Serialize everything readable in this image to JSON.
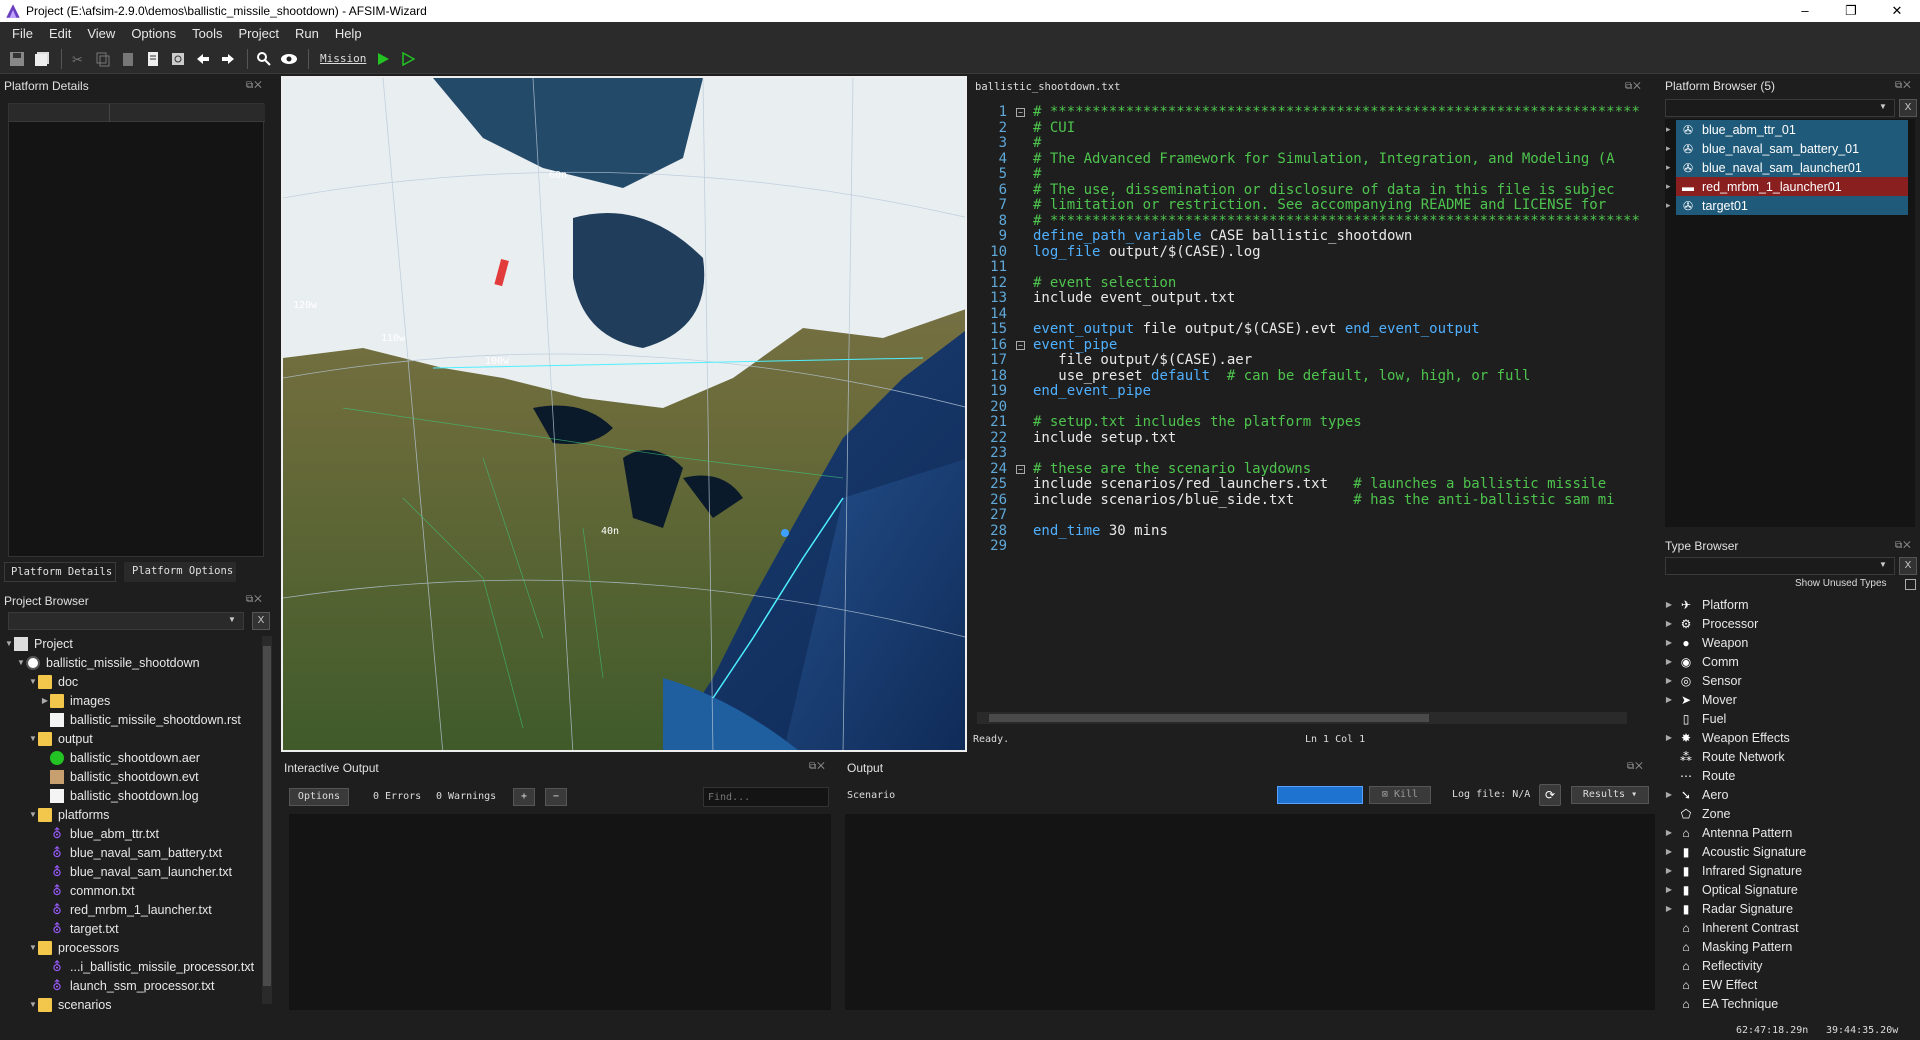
{
  "window": {
    "title": "Project (E:\\afsim-2.9.0\\demos\\ballistic_missile_shootdown) - AFSIM-Wizard",
    "min": "–",
    "max": "❐",
    "close": "✕"
  },
  "menu": [
    "File",
    "Edit",
    "View",
    "Options",
    "Tools",
    "Project",
    "Run",
    "Help"
  ],
  "toolbar": {
    "mission_label": "Mission"
  },
  "platform_details": {
    "title": "Platform Details",
    "tab_details": "Platform Details",
    "tab_options": "Platform Options"
  },
  "project_browser": {
    "title": "Project Browser",
    "items": [
      {
        "label": "Project",
        "level": 0,
        "icon": "project",
        "arrow": "▼"
      },
      {
        "label": "ballistic_missile_shootdown",
        "level": 1,
        "icon": "globe",
        "arrow": "▼"
      },
      {
        "label": "doc",
        "level": 2,
        "icon": "folder",
        "arrow": "▼"
      },
      {
        "label": "images",
        "level": 3,
        "icon": "folder",
        "arrow": "▶"
      },
      {
        "label": "ballistic_missile_shootdown.rst",
        "level": 3,
        "icon": "file",
        "arrow": ""
      },
      {
        "label": "output",
        "level": 2,
        "icon": "folder",
        "arrow": "▼"
      },
      {
        "label": "ballistic_shootdown.aer",
        "level": 3,
        "icon": "green",
        "arrow": ""
      },
      {
        "label": "ballistic_shootdown.evt",
        "level": 3,
        "icon": "evt",
        "arrow": ""
      },
      {
        "label": "ballistic_shootdown.log",
        "level": 3,
        "icon": "file",
        "arrow": ""
      },
      {
        "label": "platforms",
        "level": 2,
        "icon": "folder",
        "arrow": "▼"
      },
      {
        "label": "blue_abm_ttr.txt",
        "level": 3,
        "icon": "purple",
        "arrow": ""
      },
      {
        "label": "blue_naval_sam_battery.txt",
        "level": 3,
        "icon": "purple",
        "arrow": ""
      },
      {
        "label": "blue_naval_sam_launcher.txt",
        "level": 3,
        "icon": "purple",
        "arrow": ""
      },
      {
        "label": "common.txt",
        "level": 3,
        "icon": "purple",
        "arrow": ""
      },
      {
        "label": "red_mrbm_1_launcher.txt",
        "level": 3,
        "icon": "purple",
        "arrow": ""
      },
      {
        "label": "target.txt",
        "level": 3,
        "icon": "purple",
        "arrow": ""
      },
      {
        "label": "processors",
        "level": 2,
        "icon": "folder",
        "arrow": "▼"
      },
      {
        "label": "...i_ballistic_missile_processor.txt",
        "level": 3,
        "icon": "purple",
        "arrow": ""
      },
      {
        "label": "launch_ssm_processor.txt",
        "level": 3,
        "icon": "purple",
        "arrow": ""
      },
      {
        "label": "scenarios",
        "level": 2,
        "icon": "folder",
        "arrow": "▼"
      }
    ]
  },
  "map": {
    "labels": [
      "60n",
      "120w",
      "110w",
      "100w",
      "40n"
    ]
  },
  "editor": {
    "tab": "ballistic_shootdown.txt",
    "status_left": "Ready.",
    "status_pos": "Ln 1 Col 1",
    "lines": [
      [
        [
          "cm",
          "# **********************************************************************"
        ]
      ],
      [
        [
          "cm",
          "# CUI"
        ]
      ],
      [
        [
          "cm",
          "#"
        ]
      ],
      [
        [
          "cm",
          "# The Advanced Framework for Simulation, Integration, and Modeling (A"
        ]
      ],
      [
        [
          "cm",
          "#"
        ]
      ],
      [
        [
          "cm",
          "# The use, dissemination or disclosure of data in this file is subjec"
        ]
      ],
      [
        [
          "cm",
          "# limitation or restriction. See accompanying README and LICENSE for"
        ]
      ],
      [
        [
          "cm",
          "# **********************************************************************"
        ]
      ],
      [
        [
          "kw",
          "define_path_variable"
        ],
        [
          "tx",
          " CASE ballistic_shootdown"
        ]
      ],
      [
        [
          "kw",
          "log_file"
        ],
        [
          "tx",
          " output/$(CASE).log"
        ]
      ],
      [],
      [
        [
          "cm",
          "# event selection"
        ]
      ],
      [
        [
          "tx",
          "include event_output.txt"
        ]
      ],
      [],
      [
        [
          "kw",
          "event_output"
        ],
        [
          "tx",
          " file output/$(CASE).evt "
        ],
        [
          "kw",
          "end_event_output"
        ]
      ],
      [
        [
          "kw",
          "event_pipe"
        ]
      ],
      [
        [
          "tx",
          "   file output/$(CASE).aer"
        ]
      ],
      [
        [
          "tx",
          "   use_preset "
        ],
        [
          "kw",
          "default"
        ],
        [
          "tx",
          "  "
        ],
        [
          "cm",
          "# can be default, low, high, or full"
        ]
      ],
      [
        [
          "kw",
          "end_event_pipe"
        ]
      ],
      [],
      [
        [
          "cm",
          "# setup.txt includes the platform types"
        ]
      ],
      [
        [
          "tx",
          "include setup.txt"
        ]
      ],
      [],
      [
        [
          "cm",
          "# these are the scenario laydowns"
        ]
      ],
      [
        [
          "tx",
          "include scenarios/red_launchers.txt   "
        ],
        [
          "cm",
          "# launches a ballistic missile"
        ]
      ],
      [
        [
          "tx",
          "include scenarios/blue_side.txt       "
        ],
        [
          "cm",
          "# has the anti-ballistic sam mi"
        ]
      ],
      [],
      [
        [
          "kw",
          "end_time"
        ],
        [
          "tx",
          " 30 mins"
        ]
      ],
      []
    ]
  },
  "platform_browser": {
    "title": "Platform Browser (5)",
    "items": [
      {
        "label": "blue_abm_ttr_01",
        "side": "blue"
      },
      {
        "label": "blue_naval_sam_battery_01",
        "side": "blue"
      },
      {
        "label": "blue_naval_sam_launcher01",
        "side": "blue"
      },
      {
        "label": "red_mrbm_1_launcher01",
        "side": "red"
      },
      {
        "label": "target01",
        "side": "blue"
      }
    ]
  },
  "type_browser": {
    "title": "Type Browser",
    "show_unused": "Show Unused Types",
    "items": [
      {
        "label": "Platform",
        "icon": "✈",
        "arrow": "▶"
      },
      {
        "label": "Processor",
        "icon": "⚙",
        "arrow": "▶"
      },
      {
        "label": "Weapon",
        "icon": "●",
        "arrow": "▶"
      },
      {
        "label": "Comm",
        "icon": "◉",
        "arrow": "▶"
      },
      {
        "label": "Sensor",
        "icon": "◎",
        "arrow": "▶"
      },
      {
        "label": "Mover",
        "icon": "➤",
        "arrow": "▶"
      },
      {
        "label": "Fuel",
        "icon": "▯",
        "arrow": ""
      },
      {
        "label": "Weapon Effects",
        "icon": "✸",
        "arrow": "▶"
      },
      {
        "label": "Route Network",
        "icon": "⁂",
        "arrow": ""
      },
      {
        "label": "Route",
        "icon": "⋯",
        "arrow": ""
      },
      {
        "label": "Aero",
        "icon": "➘",
        "arrow": "▶"
      },
      {
        "label": "Zone",
        "icon": "⬠",
        "arrow": ""
      },
      {
        "label": "Antenna Pattern",
        "icon": "⌂",
        "arrow": "▶"
      },
      {
        "label": "Acoustic Signature",
        "icon": "▮",
        "arrow": "▶"
      },
      {
        "label": "Infrared Signature",
        "icon": "▮",
        "arrow": "▶"
      },
      {
        "label": "Optical Signature",
        "icon": "▮",
        "arrow": "▶"
      },
      {
        "label": "Radar Signature",
        "icon": "▮",
        "arrow": "▶"
      },
      {
        "label": "Inherent Contrast",
        "icon": "⌂",
        "arrow": ""
      },
      {
        "label": "Masking Pattern",
        "icon": "⌂",
        "arrow": ""
      },
      {
        "label": "Reflectivity",
        "icon": "⌂",
        "arrow": ""
      },
      {
        "label": "EW Effect",
        "icon": "⌂",
        "arrow": ""
      },
      {
        "label": "EA Technique",
        "icon": "⌂",
        "arrow": ""
      }
    ]
  },
  "interactive_output": {
    "title": "Interactive Output",
    "options": "Options",
    "errors": "0 Errors",
    "warnings": "0 Warnings",
    "plus": "+",
    "minus": "−",
    "find_placeholder": "Find..."
  },
  "output": {
    "title": "Output",
    "scenario_label": "Scenario",
    "kill": "Kill",
    "logfile": "Log file: N/A",
    "results": "Results"
  },
  "statusbar": {
    "lat": "62:47:18.29n",
    "lon": "39:44:35.20w"
  },
  "colors": {
    "blue_row": "#1f5a7a",
    "red_row": "#8a1f1f",
    "accent_blue": "#1e73d0"
  }
}
